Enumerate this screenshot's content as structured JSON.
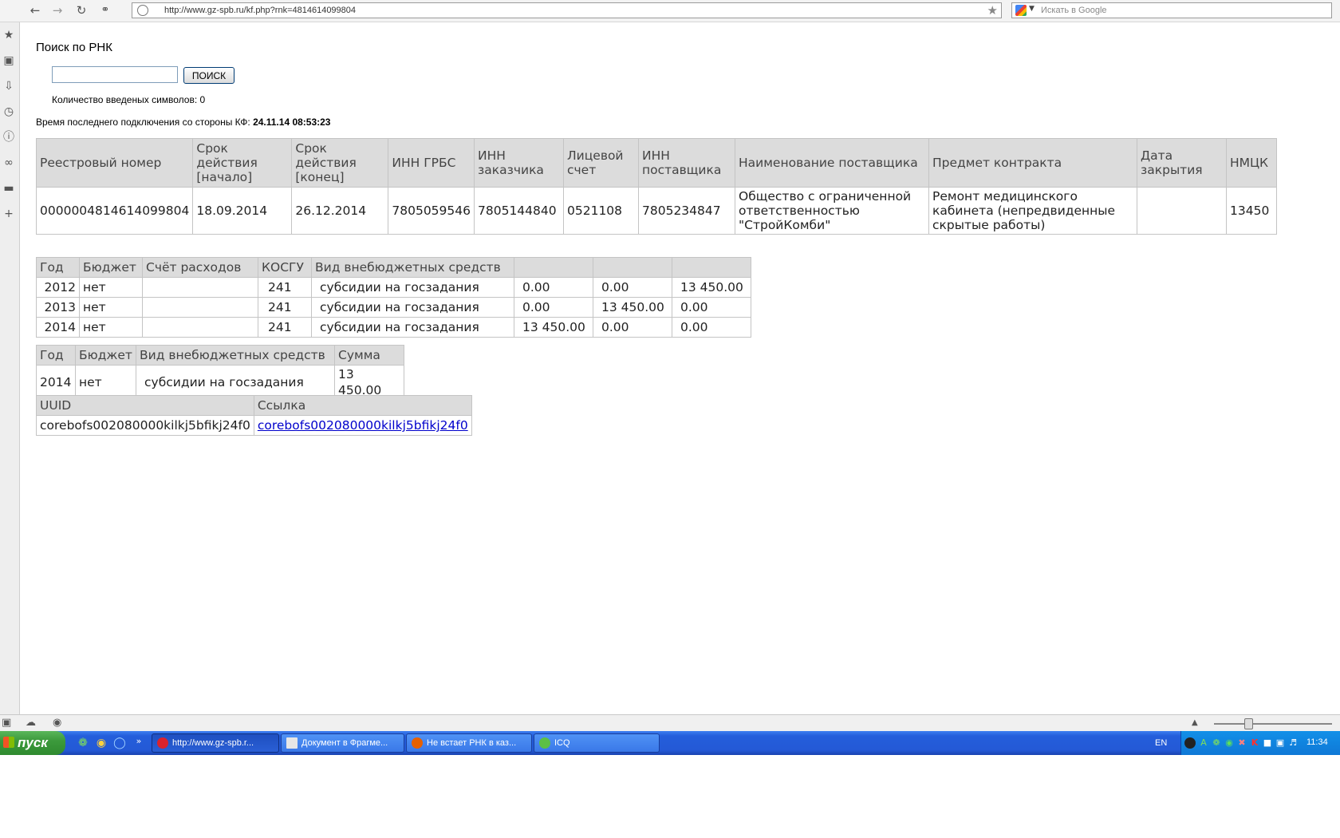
{
  "browser": {
    "url": "http://www.gz-spb.ru/kf.php?rnk=4814614099804",
    "search_placeholder": "Искать в Google"
  },
  "page": {
    "title": "Поиск по РНК",
    "search_button": "ПОИСК",
    "char_count_label": "Количество введеных символов: 0",
    "last_connection_label": "Время последнего подключения со стороны КФ:",
    "last_connection_value": "24.11.14 08:53:23"
  },
  "contract_table": {
    "headers": [
      "Реестровый номер",
      "Срок действия [начало]",
      "Срок действия [конец]",
      "ИНН ГРБС",
      "ИНН заказчика",
      "Лицевой счет",
      "ИНН поставщика",
      "Наименование поставщика",
      "Предмет контракта",
      "Дата закрытия",
      "НМЦК"
    ],
    "row": [
      "0000004814614099804",
      "18.09.2014",
      "26.12.2014",
      "7805059546",
      "7805144840",
      "0521108",
      "7805234847",
      "Общество с ограниченной ответственностью \"СтройКомби\"",
      "Ремонт медицинского кабинета (непредвиденные скрытые работы)",
      "",
      "13450"
    ]
  },
  "finance_table": {
    "headers": [
      "Год",
      "Бюджет",
      "Счёт расходов",
      "КОСГУ",
      "Вид внебюджетных средств",
      "",
      "",
      ""
    ],
    "rows": [
      [
        "2012",
        "нет",
        "",
        "241",
        "субсидии на госзадания",
        "0.00",
        "0.00",
        "13 450.00"
      ],
      [
        "2013",
        "нет",
        "",
        "241",
        "субсидии на госзадания",
        "0.00",
        "13 450.00",
        "0.00"
      ],
      [
        "2014",
        "нет",
        "",
        "241",
        "субсидии на госзадания",
        "13 450.00",
        "0.00",
        "0.00"
      ]
    ]
  },
  "summary_table": {
    "headers": [
      "Год",
      "Бюджет",
      "Вид внебюджетных средств",
      "Сумма"
    ],
    "row": [
      "2014",
      "нет",
      "субсидии на госзадания",
      "13 450.00"
    ]
  },
  "uuid_table": {
    "headers": [
      "UUID",
      "Ссылка"
    ],
    "row": [
      "corebofs002080000kilkj5bfikj24f0",
      "corebofs002080000kilkj5bfikj24f0"
    ]
  },
  "taskbar": {
    "start_label": "пуск",
    "tasks": [
      "http://www.gz-spb.r...",
      "Документ в Фрагме...",
      "Не встает РНК в каз...",
      "ICQ"
    ],
    "language": "EN",
    "clock": "11:34"
  }
}
